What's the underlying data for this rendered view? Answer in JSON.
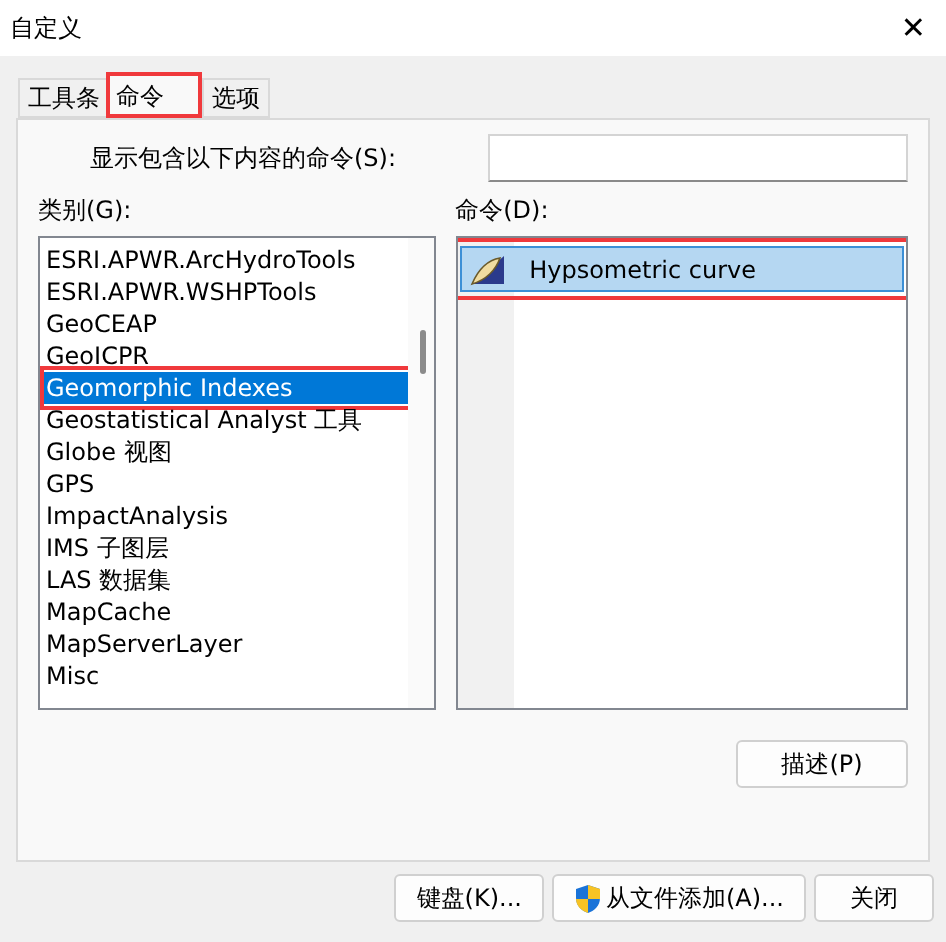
{
  "window": {
    "title": "自定义",
    "close": "✕"
  },
  "tabs": [
    {
      "label": "工具条",
      "selected": false,
      "annotated": false
    },
    {
      "label": "命令",
      "selected": true,
      "annotated": true
    },
    {
      "label": "选项",
      "selected": false,
      "annotated": false
    }
  ],
  "search": {
    "label": "显示包含以下内容的命令(S):"
  },
  "categories": {
    "label": "类别(G):",
    "items": [
      {
        "label": "ESRI.APWR.ArcHydroTools",
        "selected": false,
        "annotated": false
      },
      {
        "label": "ESRI.APWR.WSHPTools",
        "selected": false,
        "annotated": false
      },
      {
        "label": "GeoCEAP",
        "selected": false,
        "annotated": false
      },
      {
        "label": "GeoICPR",
        "selected": false,
        "annotated": false
      },
      {
        "label": "Geomorphic Indexes",
        "selected": true,
        "annotated": true
      },
      {
        "label": "Geostatistical Analyst 工具",
        "selected": false,
        "annotated": false
      },
      {
        "label": "Globe 视图",
        "selected": false,
        "annotated": false
      },
      {
        "label": "GPS",
        "selected": false,
        "annotated": false
      },
      {
        "label": "ImpactAnalysis",
        "selected": false,
        "annotated": false
      },
      {
        "label": "IMS 子图层",
        "selected": false,
        "annotated": false
      },
      {
        "label": "LAS 数据集",
        "selected": false,
        "annotated": false
      },
      {
        "label": "MapCache",
        "selected": false,
        "annotated": false
      },
      {
        "label": "MapServerLayer",
        "selected": false,
        "annotated": false
      },
      {
        "label": "Misc",
        "selected": false,
        "annotated": false
      }
    ]
  },
  "commands": {
    "label": "命令(D):",
    "items": [
      {
        "label": "Hypsometric curve",
        "selected": true,
        "annotated": true
      }
    ]
  },
  "describe_button": "描述(P)",
  "buttons": [
    {
      "label": "键盘(K)...",
      "shield": false
    },
    {
      "label": "从文件添加(A)...",
      "shield": true
    },
    {
      "label": "关闭",
      "shield": false
    }
  ]
}
